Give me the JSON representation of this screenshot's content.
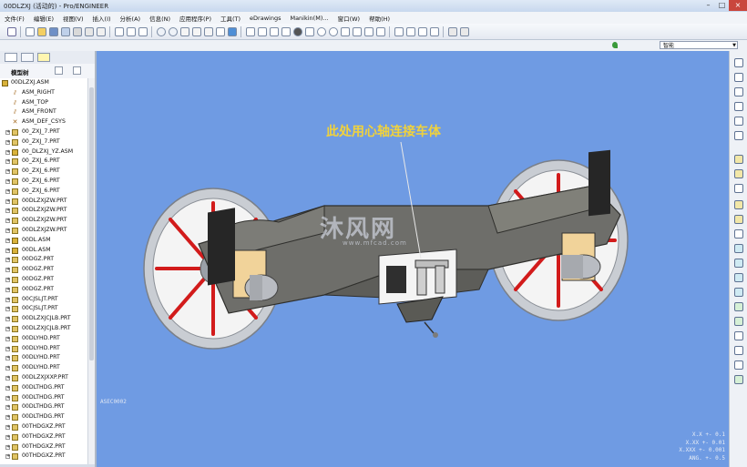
{
  "window": {
    "title": "00DLZXJ (活动的) - Pro/ENGINEER"
  },
  "menu": [
    "文件(F)",
    "编辑(E)",
    "视图(V)",
    "插入(I)",
    "分析(A)",
    "信息(N)",
    "应用程序(P)",
    "工具(T)",
    "eDrawings",
    "Manikin(M)...",
    "窗口(W)",
    "帮助(H)"
  ],
  "filter": {
    "value": "智能"
  },
  "tree": {
    "header": "模型树",
    "items": [
      {
        "label": "00DLZXJ.ASM",
        "type": "root"
      },
      {
        "label": "ASM_RIGHT",
        "type": "datum"
      },
      {
        "label": "ASM_TOP",
        "type": "datum"
      },
      {
        "label": "ASM_FRONT",
        "type": "datum"
      },
      {
        "label": "ASM_DEF_CSYS",
        "type": "csys"
      },
      {
        "label": "00_ZXJ_7.PRT",
        "type": "part"
      },
      {
        "label": "00_ZXJ_7.PRT",
        "type": "part"
      },
      {
        "label": "00_DLZXJ_YZ.ASM",
        "type": "asm"
      },
      {
        "label": "00_ZXJ_6.PRT",
        "type": "part"
      },
      {
        "label": "00_ZXJ_6.PRT",
        "type": "part"
      },
      {
        "label": "00_ZXJ_6.PRT",
        "type": "part"
      },
      {
        "label": "00_ZXJ_6.PRT",
        "type": "part"
      },
      {
        "label": "00DLZXJZW.PRT",
        "type": "part"
      },
      {
        "label": "00DLZXJZW.PRT",
        "type": "part"
      },
      {
        "label": "00DLZXJZW.PRT",
        "type": "part"
      },
      {
        "label": "00DLZXJZW.PRT",
        "type": "part"
      },
      {
        "label": "00DL.ASM",
        "type": "asm"
      },
      {
        "label": "00DL.ASM",
        "type": "asm"
      },
      {
        "label": "00DGZ.PRT",
        "type": "part"
      },
      {
        "label": "00DGZ.PRT",
        "type": "part"
      },
      {
        "label": "00DGZ.PRT",
        "type": "part"
      },
      {
        "label": "00DGZ.PRT",
        "type": "part"
      },
      {
        "label": "00CJSLJT.PRT",
        "type": "part"
      },
      {
        "label": "00CJSLJT.PRT",
        "type": "part"
      },
      {
        "label": "00DLZXJCJLB.PRT",
        "type": "part"
      },
      {
        "label": "00DLZXJCJLB.PRT",
        "type": "part"
      },
      {
        "label": "00DLYHD.PRT",
        "type": "part"
      },
      {
        "label": "00DLYHD.PRT",
        "type": "part"
      },
      {
        "label": "00DLYHD.PRT",
        "type": "part"
      },
      {
        "label": "00DLYHD.PRT",
        "type": "part"
      },
      {
        "label": "00DLZXJXXP.PRT",
        "type": "part"
      },
      {
        "label": "00DLTHDG.PRT",
        "type": "part"
      },
      {
        "label": "00DLTHDG.PRT",
        "type": "part"
      },
      {
        "label": "00DLTHDG.PRT",
        "type": "part"
      },
      {
        "label": "00DLTHDG.PRT",
        "type": "part"
      },
      {
        "label": "00THDGXZ.PRT",
        "type": "part"
      },
      {
        "label": "00THDGXZ.PRT",
        "type": "part"
      },
      {
        "label": "00THDGXZ.PRT",
        "type": "part"
      },
      {
        "label": "00THDGXZ.PRT",
        "type": "part"
      }
    ]
  },
  "viewport": {
    "annotation": "此处用心轴连接车体",
    "watermark": "沐风网",
    "watermark_url": "www.mfcad.com",
    "view_label": "ASEC0002",
    "tolerances": [
      "X.X +- 0.1",
      "X.XX +- 0.01",
      "X.XXX +- 0.001",
      "ANG. +- 0.5"
    ],
    "colors": {
      "background": "#6f9be3",
      "body": "#6e6e6a",
      "spokes": "#d21b1b",
      "wheel": "#cfd3d8",
      "pads": "#f1d39a"
    }
  }
}
